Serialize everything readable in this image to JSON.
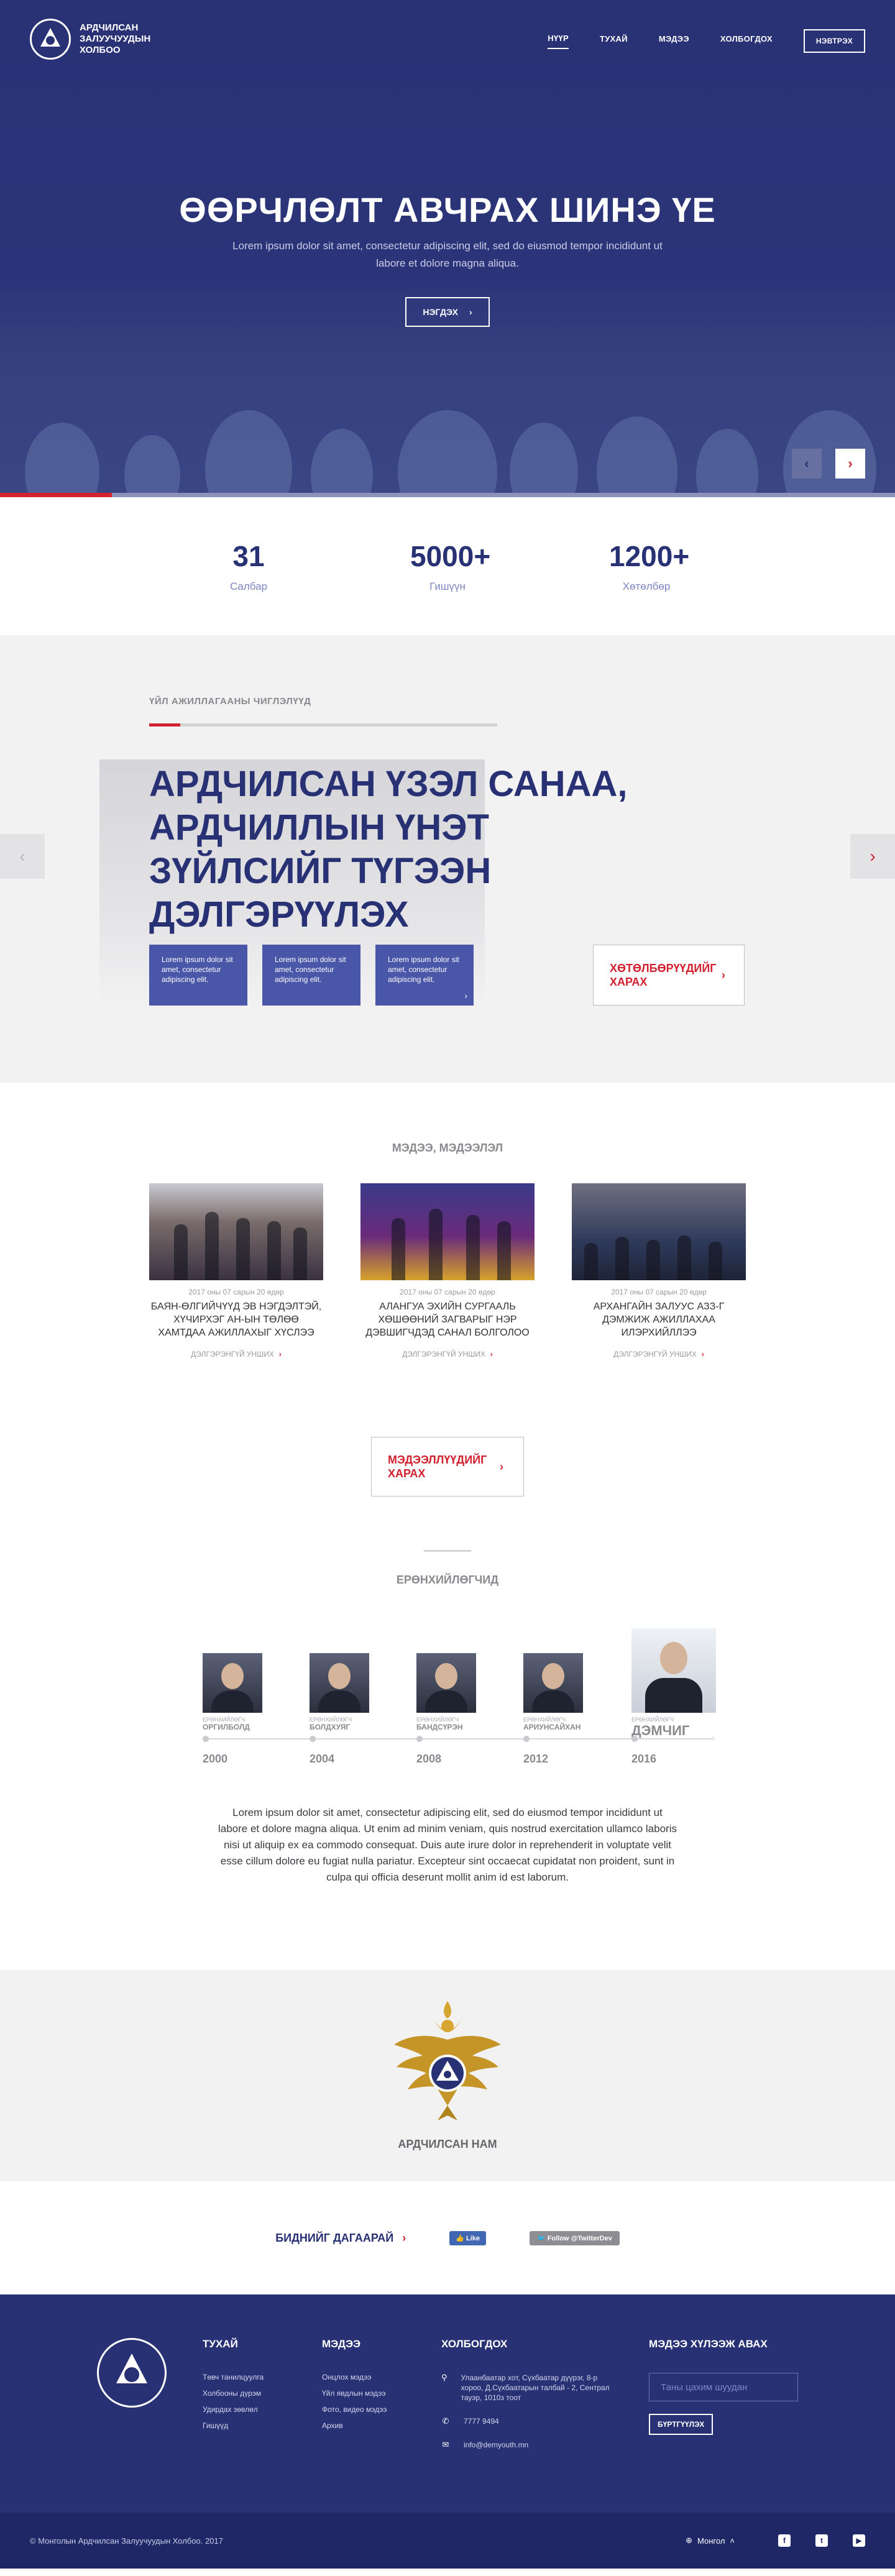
{
  "logo": {
    "text": "Ардчилсан Залуучуудын Холбоо"
  },
  "nav": {
    "items": [
      {
        "label": "НҮҮР",
        "active": true
      },
      {
        "label": "ТУХАЙ"
      },
      {
        "label": "МЭДЭЭ"
      },
      {
        "label": "ХОЛБОГДОХ"
      }
    ],
    "login": "НЭВТРЭХ"
  },
  "hero": {
    "title": "ӨӨРЧЛӨЛТ АВЧРАХ ШИНЭ ҮЕ",
    "subtitle": "Lorem ipsum dolor sit amet, consectetur adipiscing elit, sed do eiusmod tempor incididunt ut labore et dolore magna aliqua.",
    "button": "НЭГДЭХ",
    "prev_icon": "‹",
    "next_icon": "›"
  },
  "stats": [
    {
      "value": "31",
      "label": "Салбар"
    },
    {
      "value": "5000+",
      "label": "Гишүүн"
    },
    {
      "value": "1200+",
      "label": "Хөтөлбөр"
    }
  ],
  "directions": {
    "label": "ҮЙЛ АЖИЛЛАГААНЫ ЧИГЛЭЛҮҮД",
    "title": "АРДЧИЛСАН ҮЗЭЛ САНАА, АРДЧИЛЛЫН ҮНЭТ ЗҮЙЛСИЙГ ТҮГЭЭН ДЭЛГЭРҮҮЛЭХ",
    "cards": [
      {
        "text": "Lorem ipsum dolor sit amet, consectetur adipiscing elit."
      },
      {
        "text": "Lorem ipsum dolor sit amet, consectetur adipiscing elit."
      },
      {
        "text": "Lorem ipsum dolor sit amet, consectetur adipiscing elit."
      }
    ],
    "cta": "ХӨТӨЛБӨРҮҮДИЙГ ХАРАХ"
  },
  "news": {
    "heading": "МЭДЭЭ, МЭДЭЭЛЭЛ",
    "items": [
      {
        "date": "2017 оны 07 сарын 20 өдөр",
        "title": "БАЯН-ӨЛГИЙЧҮҮД ЭВ НЭГДЭЛТЭЙ, ХҮЧИРХЭГ АН-ЫН ТӨЛӨӨ ХАМТДАА АЖИЛЛАХЫГ ХҮСЛЭЭ",
        "more": "ДЭЛГЭРЭНГҮЙ УНШИХ"
      },
      {
        "date": "2017 оны 07 сарын 20 өдөр",
        "title": "АЛАНГУА ЭХИЙН СУРГААЛЬ ХӨШӨӨНИЙ ЗАГВАРЫГ НЭР ДЭВШИГЧДЭД САНАЛ БОЛГОЛОО",
        "more": "ДЭЛГЭРЭНГҮЙ УНШИХ"
      },
      {
        "date": "2017 оны 07 сарын 20 өдөр",
        "title": "АРХАНГАЙН ЗАЛУУС АЗЗ-Г ДЭМЖИЖ АЖИЛЛАХАА ИЛЭРХИЙЛЛЭЭ",
        "more": "ДЭЛГЭРЭНГҮЙ УНШИХ"
      }
    ],
    "cta": "МЭДЭЭЛЛҮҮДИЙГ ХАРАХ"
  },
  "leaders": {
    "heading": "ЕРӨНХИЙЛӨГЧИД",
    "items": [
      {
        "role": "ЕРӨНХИЙЛӨГЧ",
        "name": "ОРГИЛБОЛД",
        "year": "2000"
      },
      {
        "role": "ЕРӨНХИЙЛӨГЧ",
        "name": "БОЛДХУЯГ",
        "year": "2004"
      },
      {
        "role": "ЕРӨНХИЙЛӨГЧ",
        "name": "БАНДСҮРЭН",
        "year": "2008"
      },
      {
        "role": "ЕРӨНХИЙЛӨГЧ",
        "name": "АРИУНСАЙХАН",
        "year": "2012"
      },
      {
        "role": "ЕРӨНХИЙЛӨГЧ",
        "name": "ДЭМЧИГ",
        "year": "2016"
      }
    ],
    "text": "Lorem ipsum dolor sit amet, consectetur adipiscing elit, sed do eiusmod tempor incididunt ut labore et dolore magna aliqua. Ut enim ad minim veniam, quis nostrud exercitation ullamco laboris nisi ut aliquip ex ea commodo consequat. Duis aute irure dolor in reprehenderit in voluptate velit esse cillum dolore eu fugiat nulla pariatur. Excepteur sint occaecat cupidatat non proident, sunt in culpa qui officia deserunt mollit anim id est laborum."
  },
  "party": {
    "name": "АРДЧИЛСАН НАМ"
  },
  "social": {
    "follow": "БИДНИЙГ ДАГААРАЙ",
    "fb": "Like",
    "tw": "Follow @TwitterDev"
  },
  "footer": {
    "about": {
      "heading": "ТУХАЙ",
      "links": [
        "Төвч танилцуулга",
        "Холбооны дүрэм",
        "Удирдах зөвлөл",
        "Гишүүд"
      ]
    },
    "news": {
      "heading": "МЭДЭЭ",
      "links": [
        "Онцлох мэдээ",
        "Үйл явдлын мэдээ",
        "Фото, видео мэдээ",
        "Архив"
      ]
    },
    "contact": {
      "heading": "ХОЛБОГДОХ",
      "address": "Улаанбаатар хот, Сүхбаатар дүүрэг, 8-р хороо, Д.Сүхбаатарын талбай - 2, Сентрал тауэр, 1010з тоот",
      "phone": "7777 9494",
      "email": "info@demyouth.mn"
    },
    "newsletter": {
      "heading": "МЭДЭЭ ХҮЛЭЭЖ АВАХ",
      "placeholder": "Таны цахим шуудан",
      "button": "БҮРТГҮҮЛЭХ"
    },
    "copyright": "© Монголын Ардчилсан Залуучуудын Холбоо. 2017",
    "language": "Монгол"
  },
  "colors": {
    "navy": "#283174",
    "accent": "#d2222f",
    "light_bg": "#f2f2f3"
  }
}
